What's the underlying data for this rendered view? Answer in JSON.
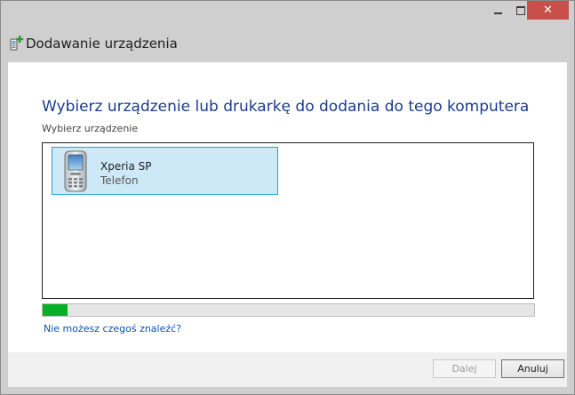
{
  "window": {
    "title": "Dodawanie urządzenia",
    "controls": {
      "minimize_icon": "minimize-icon",
      "maximize_icon": "maximize-icon",
      "close_glyph": "✕"
    },
    "close_color": "#c7504b"
  },
  "main": {
    "instruction": "Wybierz urządzenie lub drukarkę do dodania do tego komputera",
    "subtitle": "Wybierz urządzenie",
    "devices": [
      {
        "name": "Xperia SP",
        "type": "Telefon",
        "icon": "phone-icon",
        "selected": true
      }
    ],
    "search_progress": 0.05,
    "help_link": "Nie możesz czegoś znaleźć?"
  },
  "footer": {
    "next_label": "Dalej",
    "cancel_label": "Anuluj"
  },
  "colors": {
    "instruction_text": "#1a3c8c",
    "selection_fill": "#cde8f6",
    "selection_border": "#26a0da",
    "progress_fill": "#06b025",
    "link": "#0a50b4"
  }
}
